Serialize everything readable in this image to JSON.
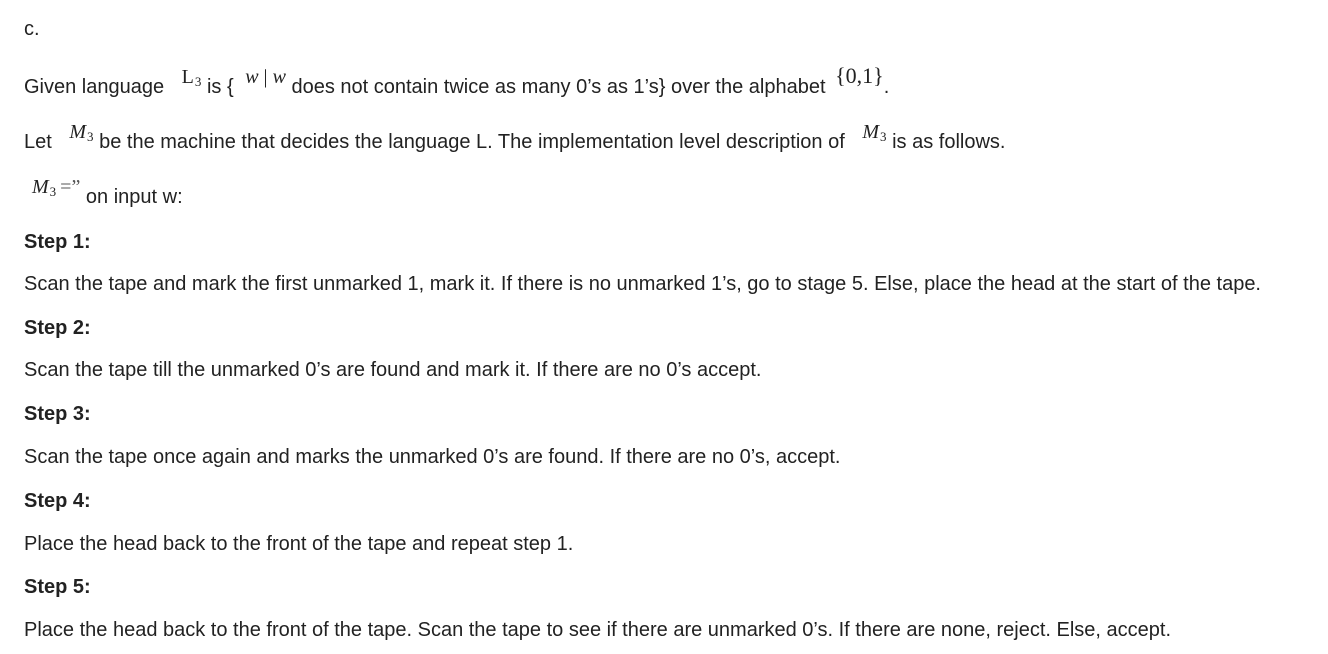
{
  "part_label": "c.",
  "line1": {
    "given": "Given language",
    "lang_letter": "L",
    "lang_sub": "3",
    "is": "is {",
    "w1": "w",
    "bar": "|",
    "w2": "w",
    "condition": "does not contain twice as many 0’s as 1’s} over the alphabet",
    "alphabet": "{0,1}",
    "period": "."
  },
  "line2": {
    "let": "Let",
    "machine_letter": "M",
    "machine_sub": "3",
    "middle": "be the machine that decides the language L. The implementation level description of",
    "machine_letter2": "M",
    "machine_sub2": "3",
    "end": "is as follows."
  },
  "line3": {
    "machine_letter": "M",
    "machine_sub": "3",
    "equals": "=",
    "quote": "”",
    "text": "on input w:"
  },
  "steps": [
    {
      "heading": "Step 1:",
      "text": "Scan the tape and mark the first unmarked 1, mark it. If there is no unmarked 1’s, go to stage 5. Else, place the head at the start of the tape."
    },
    {
      "heading": "Step 2:",
      "text": "Scan the tape till the unmarked 0’s are found and mark it. If there are no 0’s accept."
    },
    {
      "heading": "Step 3:",
      "text": "Scan the tape once again and marks the unmarked 0’s are found. If there are no 0’s, accept."
    },
    {
      "heading": "Step 4:",
      "text": "Place the head back to the front of the tape and repeat step 1."
    },
    {
      "heading": "Step 5:",
      "text": "Place the head back to the front of the tape. Scan the tape to see if there are unmarked 0’s. If there are none, reject. Else, accept."
    }
  ]
}
